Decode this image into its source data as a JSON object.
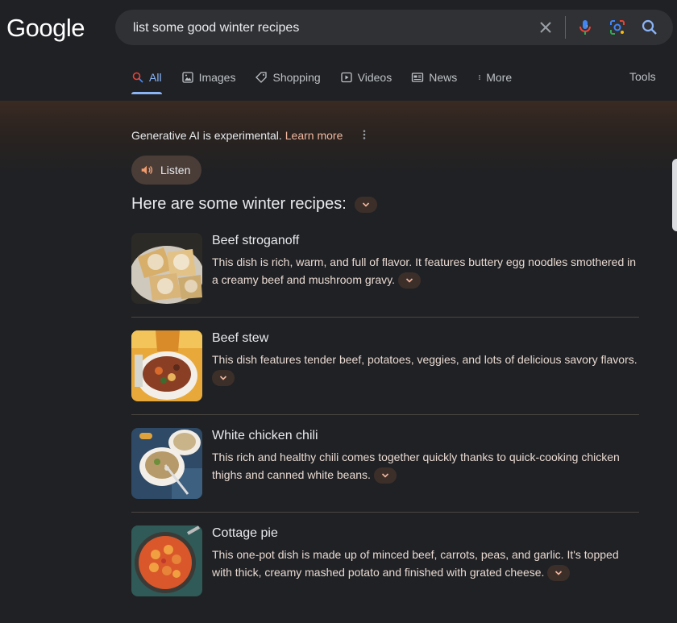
{
  "logo": "Google",
  "search": {
    "query": "list some good winter recipes"
  },
  "tabs": [
    {
      "label": "All",
      "icon": "search-icon"
    },
    {
      "label": "Images",
      "icon": "image-icon"
    },
    {
      "label": "Shopping",
      "icon": "tag-icon"
    },
    {
      "label": "Videos",
      "icon": "play-icon"
    },
    {
      "label": "News",
      "icon": "newspaper-icon"
    },
    {
      "label": "More",
      "icon": "more-vert-icon"
    }
  ],
  "tools_label": "Tools",
  "ai": {
    "notice": "Generative AI is experimental.",
    "learn_more": "Learn more",
    "listen_label": "Listen",
    "heading": "Here are some winter recipes:"
  },
  "recipes": [
    {
      "title": "Beef stroganoff",
      "description": "This dish is rich, warm, and full of flavor. It features buttery egg noodles smothered in a creamy beef and mushroom gravy."
    },
    {
      "title": "Beef stew",
      "description": "This dish features tender beef, potatoes, veggies, and lots of delicious savory flavors."
    },
    {
      "title": "White chicken chili",
      "description": "This rich and healthy chili comes together quickly thanks to quick-cooking chicken thighs and canned white beans."
    },
    {
      "title": "Cottage pie",
      "description": "This one-pot dish is made up of minced beef, carrots, peas, and garlic. It's topped with thick, creamy mashed potato and finished with grated cheese."
    }
  ],
  "colors": {
    "accent": "#8ab4f8",
    "background": "#202124",
    "learn_more": "#f2b8a0"
  }
}
